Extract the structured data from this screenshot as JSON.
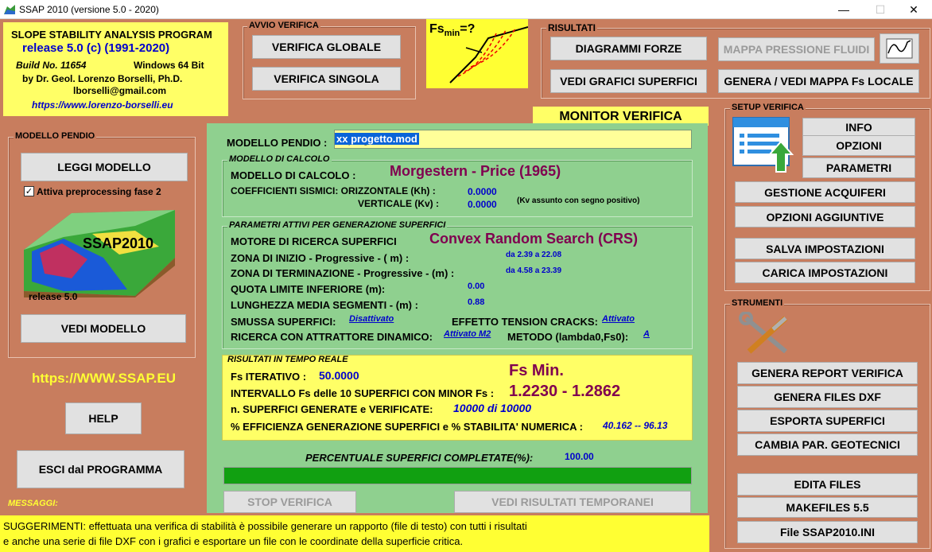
{
  "window": {
    "title": "SSAP 2010 (versione 5.0 - 2020)",
    "controls": [
      "—",
      "☐",
      "✕"
    ]
  },
  "info": {
    "line1": "SLOPE STABILITY ANALYSIS PROGRAM",
    "line2": "release 5.0  (c)  (1991-2020)",
    "build": "Build No. 11654",
    "platform": "Windows 64 Bit",
    "author": "by Dr. Geol. Lorenzo Borselli, Ph.D.",
    "email": "lborselli@gmail.com",
    "url": "https://www.lorenzo-borselli.eu"
  },
  "avvio": {
    "label": "AVVIO VERIFICA",
    "globale": "VERIFICA GLOBALE",
    "singola": "VERIFICA SINGOLA"
  },
  "logo_fs": "Fs",
  "logo_fs_sub": "min",
  "logo_fs_suffix": "=?",
  "risultati": {
    "label": "RISULTATI",
    "diagrammi": "DIAGRAMMI FORZE",
    "mappa": "MAPPA PRESSIONE FLUIDI",
    "grafici": "VEDI GRAFICI SUPERFICI",
    "genera_mappa": "GENERA / VEDI MAPPA Fs LOCALE"
  },
  "monitor_title": "MONITOR VERIFICA",
  "modello_pendio_group": {
    "label": "MODELLO PENDIO",
    "leggi": "LEGGI MODELLO",
    "preprocessing": "Attiva preprocessing fase 2",
    "preprocessing_checked": true,
    "image_text": "SSAP2010",
    "release": "release 5.0",
    "vedi": "VEDI MODELLO"
  },
  "site_url": "https://WWW.SSAP.EU",
  "help": "HELP",
  "esci": "ESCI dal PROGRAMMA",
  "messaggi": "MESSAGGI:",
  "monitor": {
    "modello_label": "MODELLO PENDIO :",
    "modello_value": "xx progetto.mod",
    "calcolo_group": "MODELLO DI CALCOLO",
    "calcolo_label": "MODELLO DI CALCOLO :",
    "calcolo_value": "Morgestern  - Price (1965)",
    "coeff_label": "COEFFICIENTI SISMICI:  ORIZZONTALE (Kh) :",
    "coeff_kh": "0.0000",
    "vert_label": "VERTICALE    (Kv) :",
    "coeff_kv": "0.0000",
    "kv_note": "(Kv assunto con segno positivo)",
    "param_group": "PARAMETRI ATTIVI PER GENERAZIONE SUPERFICI",
    "motore_label": "MOTORE DI RICERCA SUPERFICI",
    "motore_value": "Convex Random Search (CRS)",
    "inizio_label": "ZONA DI INIZIO - Progressive - ( m) :",
    "inizio_value": "da 2.39 a 22.08",
    "termine_label": "ZONA DI TERMINAZIONE - Progressive - (m) :",
    "termine_value": "da 4.58 a 23.39",
    "quota_label": "QUOTA LIMITE INFERIORE (m):",
    "quota_value": "0.00",
    "lunghezza_label": "LUNGHEZZA MEDIA SEGMENTI - (m) :",
    "lunghezza_value": "0.88",
    "smussa_label": "SMUSSA SUPERFICI:",
    "smussa_value": "Disattivato",
    "tension_label": "EFFETTO TENSION CRACKS:",
    "tension_value": "Attivato",
    "attrattore_label": "RICERCA CON ATTRATTORE DINAMICO:",
    "attrattore_value": "Attivato M2",
    "metodo_label": "METODO (lambda0,Fs0):",
    "metodo_value": "A",
    "rt_group": "RISULTATI IN TEMPO REALE",
    "fs_iter_label": "Fs ITERATIVO :",
    "fs_iter_value": "50.0000",
    "fs_min_label": "Fs Min.",
    "intervallo_label": "INTERVALLO Fs delle 10 SUPERFICI CON MINOR Fs :",
    "intervallo_value": "1.2230 - 1.2862",
    "nsup_label": "n. SUPERFICI GENERATE e VERIFICATE:",
    "nsup_value": "10000 di 10000",
    "eff_label": "% EFFICIENZA GENERAZIONE SUPERFICI e % STABILITA' NUMERICA :",
    "eff_value": "40.162 -- 96.13",
    "perc_label": "PERCENTUALE SUPERFICI COMPLETATE(%):",
    "perc_value": "100.00",
    "progress": 1.0,
    "stop": "STOP VERIFICA",
    "vedi_temp": "VEDI RISULTATI TEMPORANEI"
  },
  "setup": {
    "label": "SETUP VERIFICA",
    "info": "INFO",
    "opzioni": "OPZIONI",
    "parametri": "PARAMETRI",
    "acquiferi": "GESTIONE ACQUIFERI",
    "aggiuntive": "OPZIONI AGGIUNTIVE",
    "salva": "SALVA IMPOSTAZIONI",
    "carica": "CARICA IMPOSTAZIONI"
  },
  "strumenti": {
    "label": "STRUMENTI",
    "report": "GENERA REPORT VERIFICA",
    "dxf": "GENERA FILES DXF",
    "esporta": "ESPORTA SUPERFICI",
    "cambia": "CAMBIA PAR. GEOTECNICI",
    "edita": "EDITA FILES",
    "makefiles": "MAKEFILES  5.5",
    "ini": "File SSAP2010.INI"
  },
  "suggerimenti": {
    "line1": "SUGGERIMENTI: effettuata una verifica di stabilità è possibile generare un rapporto (file di testo) con tutti i risultati",
    "line2": "e anche una serie di file DXF con i grafici e esportare un file con le coordinate della superficie critica."
  },
  "colors": {
    "background": "#c87d5e",
    "monitor_bg": "#8fd08f",
    "yellow": "#ffff66",
    "progress": "#11a011",
    "title_blue": "#0000cc",
    "result_purple": "#800050"
  }
}
